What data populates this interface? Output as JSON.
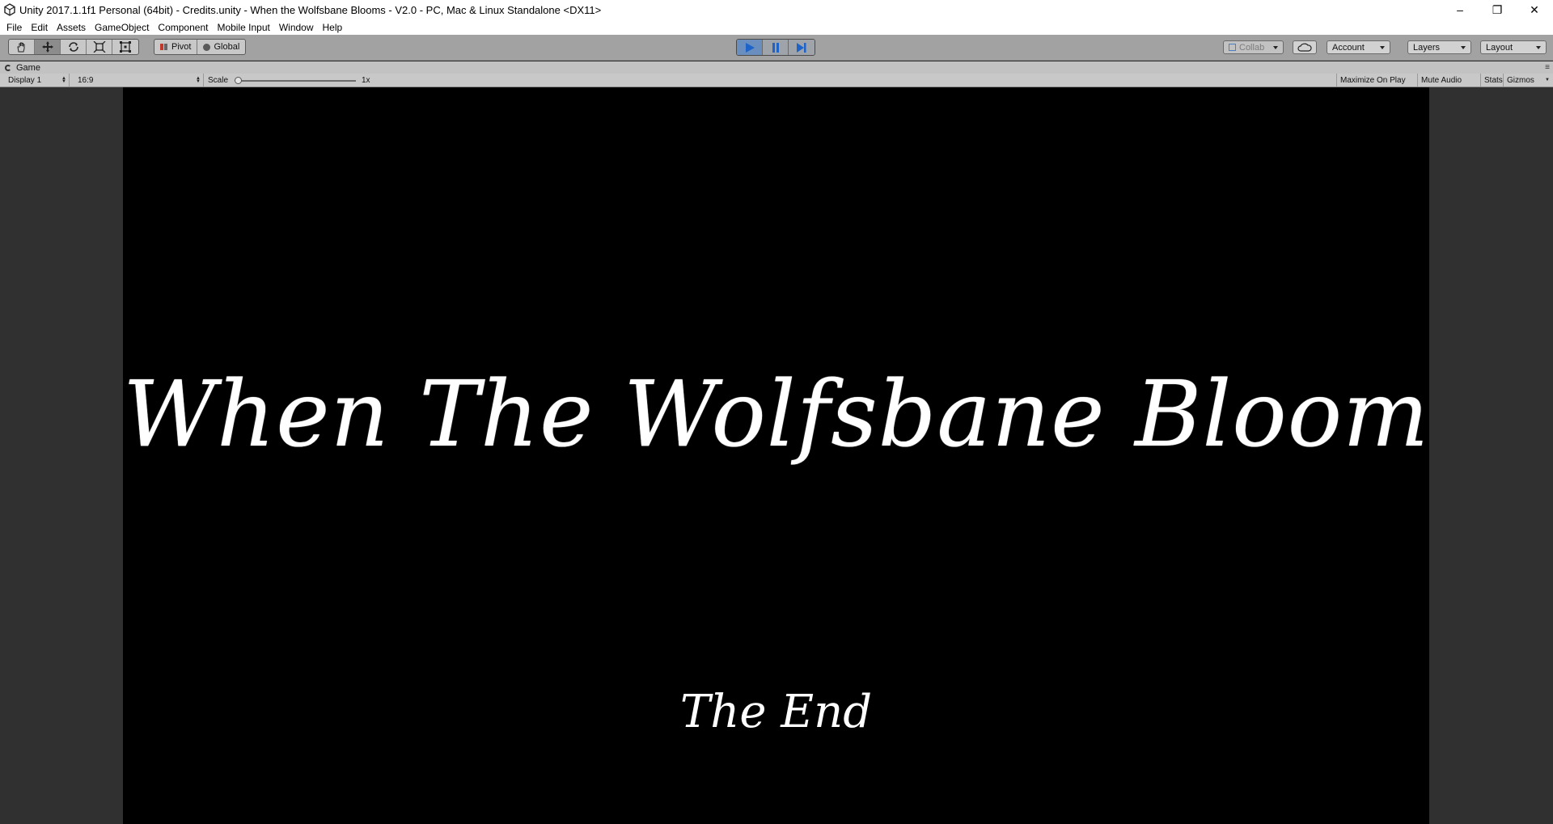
{
  "window": {
    "title": "Unity 2017.1.1f1 Personal (64bit) - Credits.unity - When the Wolfsbane Blooms - V2.0 - PC, Mac & Linux Standalone <DX11>",
    "controls": {
      "minimize": "–",
      "restore": "❐",
      "close": "✕"
    }
  },
  "menu": [
    "File",
    "Edit",
    "Assets",
    "GameObject",
    "Component",
    "Mobile Input",
    "Window",
    "Help"
  ],
  "toolbar": {
    "tools": [
      "hand-tool",
      "move-tool",
      "rotate-tool",
      "scale-tool",
      "rect-tool"
    ],
    "active_tool": "move-tool",
    "pivot_label": "Pivot",
    "global_label": "Global",
    "play_state": "playing",
    "collab_label": "Collab",
    "account_label": "Account",
    "layers_label": "Layers",
    "layout_label": "Layout",
    "accent_color": "#2f6fd0"
  },
  "game_tab": {
    "tab_label": "Game",
    "display": "Display 1",
    "aspect": "16:9",
    "scale_label": "Scale",
    "scale_value_label": "1x",
    "scale_level": 0.0,
    "maximize_label": "Maximize On Play",
    "mute_label": "Mute Audio",
    "stats_label": "Stats",
    "gizmos_label": "Gizmos"
  },
  "game_screen": {
    "title_text": "When The Wolfsbane Blooms",
    "end_text": "The End",
    "background": "#000000",
    "text_color": "#ffffff"
  }
}
